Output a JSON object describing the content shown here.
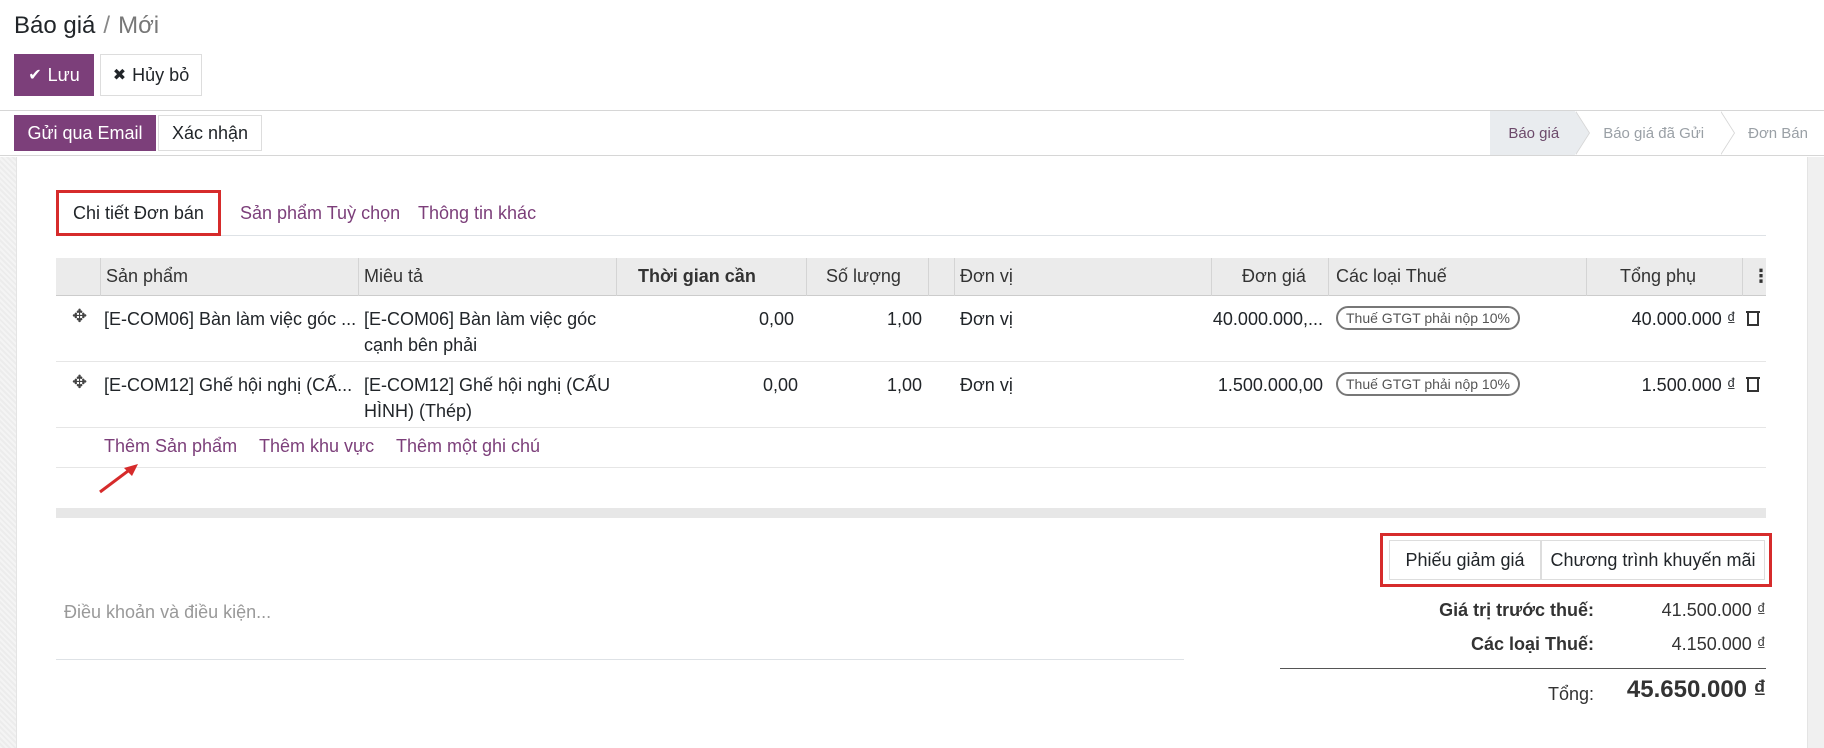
{
  "breadcrumb": {
    "parent": "Báo giá",
    "separator": "/",
    "current": "Mới"
  },
  "toolbar": {
    "save_label": "Lưu",
    "discard_label": "Hủy bỏ"
  },
  "statusbar": {
    "send_email_label": "Gửi qua Email",
    "confirm_label": "Xác nhận",
    "stages": [
      "Báo giá",
      "Báo giá đã Gửi",
      "Đơn Bán"
    ],
    "active_stage": "Báo giá"
  },
  "tabs": [
    "Chi tiết Đơn bán",
    "Sản phẩm Tuỳ chọn",
    "Thông tin khác"
  ],
  "order_lines": {
    "headers": {
      "product": "Sản phẩm",
      "description": "Miêu tả",
      "lead_time": "Thời gian cần",
      "quantity": "Số lượng",
      "uom": "Đơn vị",
      "unit_price": "Đơn giá",
      "taxes": "Các loại Thuế",
      "subtotal": "Tổng phụ"
    },
    "rows": [
      {
        "product": "[E-COM06] Bàn làm việc góc ...",
        "description_1": "[E-COM06] Bàn làm việc góc",
        "description_2": "cạnh bên phải",
        "lead_time": "0,00",
        "quantity": "1,00",
        "uom": "Đơn vị",
        "unit_price": "40.000.000,...",
        "tax": "Thuế GTGT phải nộp 10%",
        "subtotal": "40.000.000 ₫"
      },
      {
        "product": "[E-COM12] Ghế hội nghị (CẤ...",
        "description_1": "[E-COM12] Ghế hội nghị (CẤU",
        "description_2": "HÌNH) (Thép)",
        "lead_time": "0,00",
        "quantity": "1,00",
        "uom": "Đơn vị",
        "unit_price": "1.500.000,00",
        "tax": "Thuế GTGT phải nộp 10%",
        "subtotal": "1.500.000 ₫"
      }
    ],
    "add_product": "Thêm Sản phẩm",
    "add_section": "Thêm khu vực",
    "add_note": "Thêm một ghi chú"
  },
  "promotions": {
    "coupon_label": "Phiếu giảm giá",
    "program_label": "Chương trình khuyến mãi"
  },
  "terms_placeholder": "Điều khoản và điều kiện...",
  "totals": {
    "untaxed_label": "Giá trị trước thuế:",
    "untaxed_value": "41.500.000 ₫",
    "taxes_label": "Các loại Thuế:",
    "taxes_value": "4.150.000 ₫",
    "total_label": "Tổng:",
    "total_value": "45.650.000 ₫"
  },
  "colors": {
    "primary": "#7c3f7a",
    "highlight": "#d62b2b"
  }
}
